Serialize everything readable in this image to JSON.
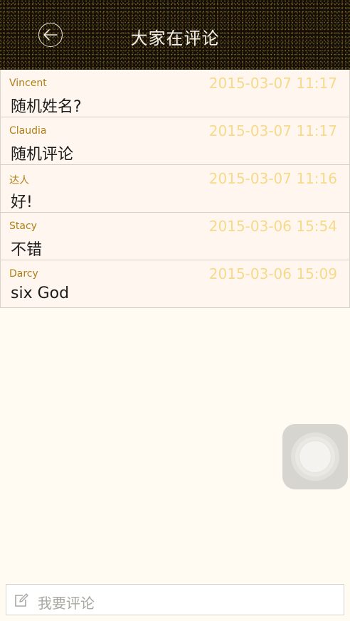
{
  "header": {
    "title": "大家在评论",
    "back_icon": "back-arrow-icon"
  },
  "comments": [
    {
      "author": "Vincent",
      "time": "2015-03-07 11:17",
      "text": "随机姓名?"
    },
    {
      "author": "Claudia",
      "time": "2015-03-07 11:17",
      "text": "随机评论"
    },
    {
      "author": "达人",
      "time": "2015-03-07 11:16",
      "text": "好!"
    },
    {
      "author": "Stacy",
      "time": "2015-03-06 15:54",
      "text": "不错"
    },
    {
      "author": "Darcy",
      "time": "2015-03-06 15:09",
      "text": "six God"
    }
  ],
  "comment_input": {
    "placeholder": "我要评论",
    "icon": "edit-icon"
  },
  "colors": {
    "author": "#b07f14",
    "time": "#f7d98a",
    "background": "#fffbf3",
    "row_background": "#fff7ef"
  }
}
